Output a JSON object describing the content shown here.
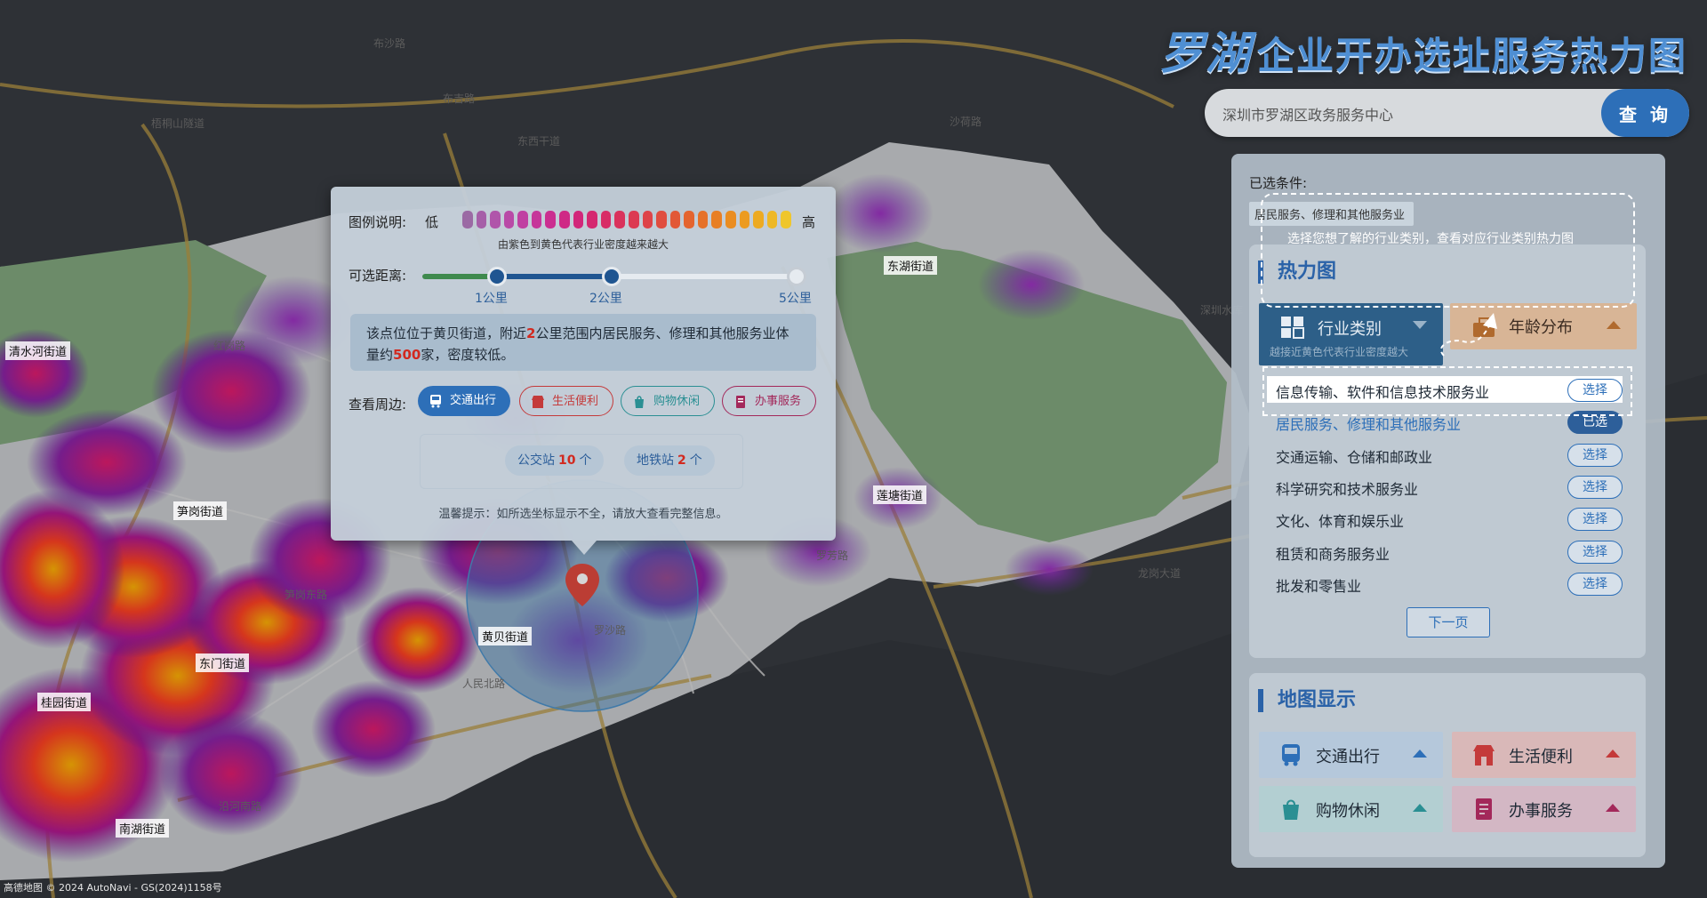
{
  "app_title": "罗湖企业开办选址服务热力图",
  "app_title_brush": "罗湖",
  "app_title_rest": "企业开办选址服务热力图",
  "search": {
    "value": "深圳市罗湖区政务服务中心",
    "button": "查 询"
  },
  "selected": {
    "label": "已选条件:",
    "chip": "居民服务、修理和其他服务业"
  },
  "overlay_hint": "选择您想了解的行业类别，查看对应行业类别热力图",
  "heat_card": {
    "title": "热力图",
    "tabs": [
      {
        "label": "行业类别",
        "sub": "越接近黄色代表行业密度越大",
        "icon": "grid-icon",
        "active": true
      },
      {
        "label": "年龄分布",
        "icon": "suitcase-icon",
        "active": false
      }
    ],
    "rows": [
      {
        "label": "信息传输、软件和信息技术服务业",
        "btn": "选择",
        "highlight": true
      },
      {
        "label": "居民服务、修理和其他服务业",
        "btn": "已选",
        "selected": true
      },
      {
        "label": "交通运输、仓储和邮政业",
        "btn": "选择"
      },
      {
        "label": "科学研究和技术服务业",
        "btn": "选择"
      },
      {
        "label": "文化、体育和娱乐业",
        "btn": "选择"
      },
      {
        "label": "租赁和商务服务业",
        "btn": "选择"
      },
      {
        "label": "批发和零售业",
        "btn": "选择"
      }
    ],
    "next_button": "下一页"
  },
  "map_card": {
    "title": "地图显示",
    "tiles": [
      {
        "label": "交通出行",
        "icon": "bus-icon",
        "bg": "#b5c8db",
        "color": "#2d6fb8"
      },
      {
        "label": "生活便利",
        "icon": "store-icon",
        "bg": "#d9b8b8",
        "color": "#c43a3a"
      },
      {
        "label": "购物休闲",
        "icon": "shopping-bag-icon",
        "bg": "#b3cfd2",
        "color": "#2a8f93"
      },
      {
        "label": "办事服务",
        "icon": "document-icon",
        "bg": "#d3b7c4",
        "color": "#a3285a"
      }
    ]
  },
  "popup": {
    "legend_label": "图例说明:",
    "low": "低",
    "high": "高",
    "legend_note": "由紫色到黄色代表行业密度越来越大",
    "distance_label": "可选距离:",
    "ticks": [
      "1公里",
      "2公里",
      "5公里"
    ],
    "info_prefix": "该点位位于黄贝街道，附近",
    "info_km": "2",
    "info_mid": "公里范围内居民服务、修理和其他服务业体量约",
    "info_count": "500",
    "info_suffix": "家，密度较低。",
    "nearby_label": "查看周边:",
    "nearby_buttons": [
      {
        "label": "交通出行",
        "icon": "bus-icon",
        "active": true
      },
      {
        "label": "生活便利",
        "icon": "store-icon"
      },
      {
        "label": "购物休闲",
        "icon": "shopping-bag-icon"
      },
      {
        "label": "办事服务",
        "icon": "document-icon"
      }
    ],
    "bus_label": "公交站",
    "bus_count": "10",
    "metro_label": "地铁站",
    "metro_count": "2",
    "unit": "个",
    "tip": "温馨提示：如所选坐标显示不全，请放大查看完整信息。"
  },
  "map_labels": {
    "districts": [
      "清水河街道",
      "笋岗街道",
      "东门街道",
      "桂园街道",
      "南湖街道",
      "黄贝街道",
      "莲塘街道",
      "东湖街道"
    ],
    "roads": [
      "沙荷路",
      "东西干道",
      "布吉路",
      "布沙路",
      "罗沙路",
      "沿河南路",
      "梧桐山隧道",
      "深圳水库",
      "笋岗东路",
      "红岗路",
      "人民北路",
      "罗芳路",
      "龙岗大道"
    ]
  },
  "footer": "高德地图 © 2024 AutoNavi - GS(2024)1158号"
}
